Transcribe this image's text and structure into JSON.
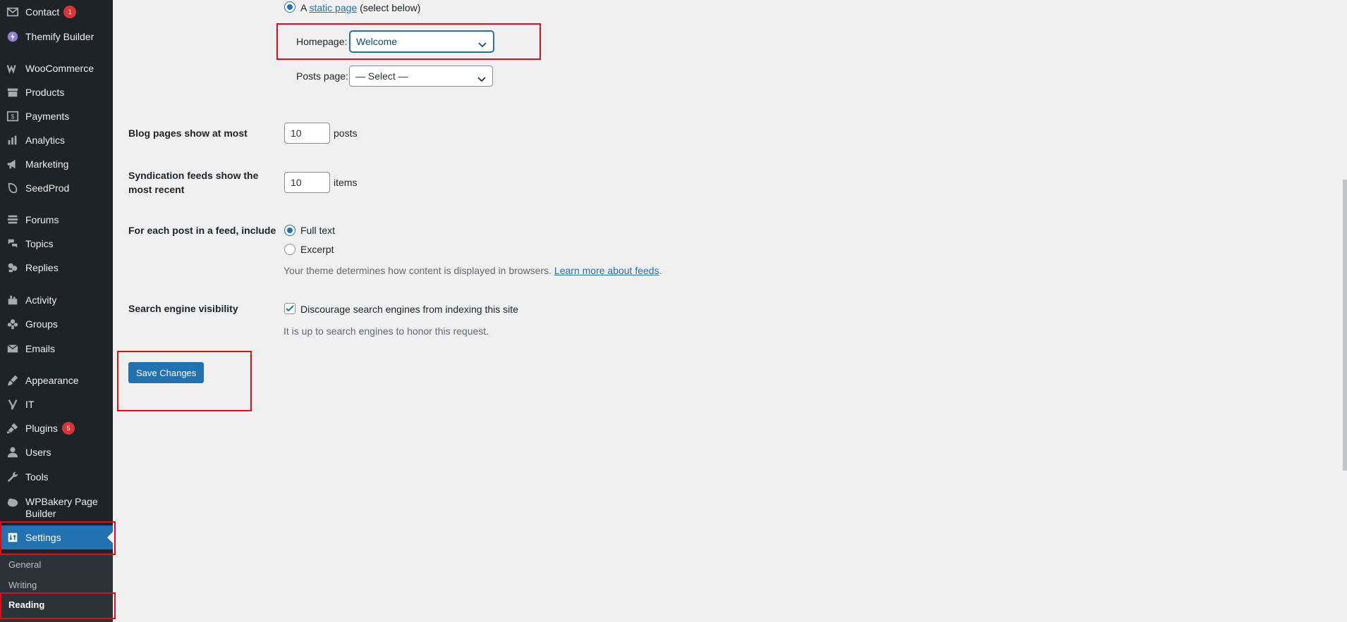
{
  "sidebar": {
    "items": [
      {
        "label": "Contact",
        "icon": "envelope-icon",
        "badge": "1"
      },
      {
        "label": "Themify Builder",
        "icon": "themify-icon"
      },
      {
        "label": "WooCommerce",
        "icon": "woocommerce-icon"
      },
      {
        "label": "Products",
        "icon": "archive-icon"
      },
      {
        "label": "Payments",
        "icon": "dollar-icon"
      },
      {
        "label": "Analytics",
        "icon": "bar-chart-icon"
      },
      {
        "label": "Marketing",
        "icon": "megaphone-icon"
      },
      {
        "label": "SeedProd",
        "icon": "seedprod-icon"
      },
      {
        "label": "Forums",
        "icon": "forums-icon"
      },
      {
        "label": "Topics",
        "icon": "topics-icon"
      },
      {
        "label": "Replies",
        "icon": "replies-icon"
      },
      {
        "label": "Activity",
        "icon": "activity-icon"
      },
      {
        "label": "Groups",
        "icon": "groups-icon"
      },
      {
        "label": "Emails",
        "icon": "envelope-icon"
      },
      {
        "label": "Appearance",
        "icon": "paintbrush-icon"
      },
      {
        "label": "IT",
        "icon": "yoast-icon"
      },
      {
        "label": "Plugins",
        "icon": "plugin-icon",
        "badge": "5"
      },
      {
        "label": "Users",
        "icon": "user-icon"
      },
      {
        "label": "Tools",
        "icon": "wrench-icon"
      },
      {
        "label": "WPBakery Page Builder",
        "icon": "cloud-icon"
      },
      {
        "label": "Settings",
        "icon": "settings-icon"
      }
    ],
    "submenu": [
      "General",
      "Writing",
      "Reading"
    ]
  },
  "reading": {
    "static_page_prefix": "A",
    "static_page_link": "static page",
    "static_page_suffix": "(select below)",
    "homepage_label": "Homepage:",
    "homepage_value": "Welcome",
    "posts_page_label": "Posts page:",
    "posts_page_value": "— Select —",
    "blog_pages_label": "Blog pages show at most",
    "blog_pages_value": "10",
    "blog_pages_unit": "posts",
    "syndication_label": "Syndication feeds show the most recent",
    "syndication_value": "10",
    "syndication_unit": "items",
    "feed_include_label": "For each post in a feed, include",
    "feed_full_text": "Full text",
    "feed_excerpt": "Excerpt",
    "feed_desc": "Your theme determines how content is displayed in browsers.",
    "feed_desc_link": "Learn more about feeds",
    "feed_desc_end": ".",
    "search_visibility_label": "Search engine visibility",
    "search_visibility_checkbox": "Discourage search engines from indexing this site",
    "search_visibility_desc": "It is up to search engines to honor this request.",
    "save_button": "Save Changes"
  },
  "colors": {
    "accent": "#2271b1",
    "sidebar_bg": "#1d2327",
    "highlight": "#e30b17",
    "badge": "#d63638"
  }
}
